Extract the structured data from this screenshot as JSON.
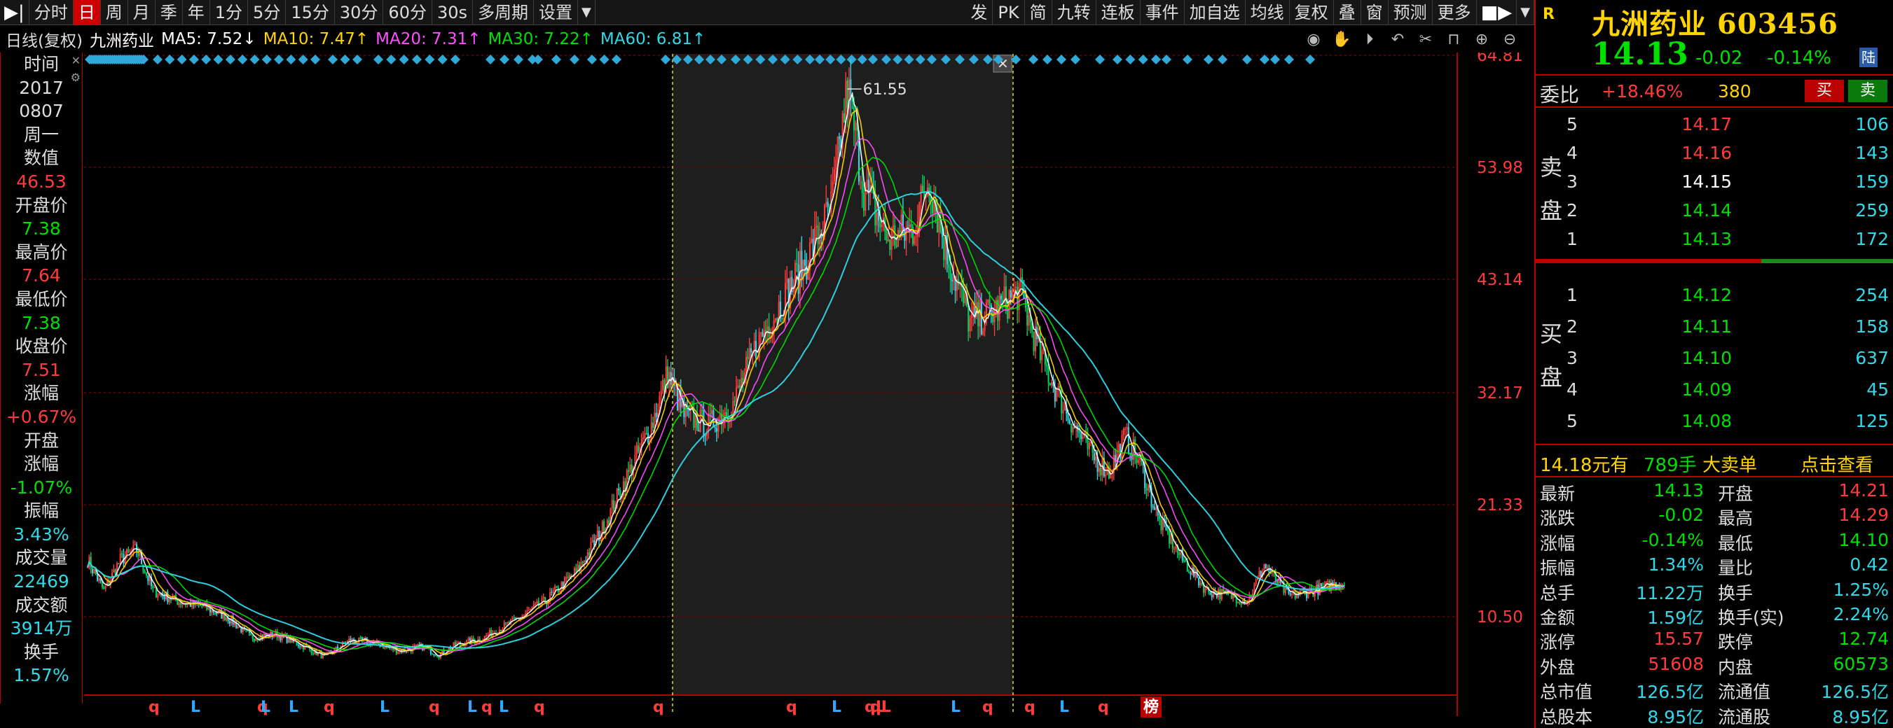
{
  "toolbar": {
    "items": [
      "分时",
      "日",
      "周",
      "月",
      "季",
      "年",
      "1分",
      "5分",
      "15分",
      "30分",
      "60分",
      "30s",
      "多周期",
      "设置"
    ],
    "active_index": 1,
    "right_items": [
      "发",
      "PK",
      "简",
      "九转",
      "连板",
      "事件",
      "加自选",
      "均线",
      "复权",
      "叠",
      "窗",
      "预测",
      "更多"
    ]
  },
  "chart_header": {
    "period": "日线(复权)",
    "stock": "九洲药业",
    "ma5": "MA5: 7.52↓",
    "ma10": "MA10: 7.47↑",
    "ma20": "MA20: 7.31↑",
    "ma30": "MA30: 7.22↑",
    "ma60": "MA60: 6.81↑"
  },
  "colors": {
    "ma5": "#ffffff",
    "ma10": "#ffd400",
    "ma20": "#ff50ff",
    "ma30": "#00e000",
    "ma60": "#30d8e8",
    "up": "#ff3b3b",
    "down": "#30d8e8",
    "grid": "#6a0000",
    "axis": "#b00000"
  },
  "left_panel": [
    {
      "t": "时间",
      "c": "lbl"
    },
    {
      "t": "2017",
      "c": "lbl"
    },
    {
      "t": "0807",
      "c": "lbl"
    },
    {
      "t": "周一",
      "c": "lbl"
    },
    {
      "t": "数值",
      "c": "lbl"
    },
    {
      "t": "46.53",
      "c": "red"
    },
    {
      "t": "开盘价",
      "c": "lbl"
    },
    {
      "t": "7.38",
      "c": "green"
    },
    {
      "t": "最高价",
      "c": "lbl"
    },
    {
      "t": "7.64",
      "c": "red"
    },
    {
      "t": "最低价",
      "c": "lbl"
    },
    {
      "t": "7.38",
      "c": "green"
    },
    {
      "t": "收盘价",
      "c": "lbl"
    },
    {
      "t": "7.51",
      "c": "red"
    },
    {
      "t": "涨幅",
      "c": "lbl"
    },
    {
      "t": "+0.67%",
      "c": "red"
    },
    {
      "t": "开盘",
      "c": "lbl"
    },
    {
      "t": "涨幅",
      "c": "lbl"
    },
    {
      "t": "-1.07%",
      "c": "green"
    },
    {
      "t": "振幅",
      "c": "lbl"
    },
    {
      "t": "3.43%",
      "c": "cyan"
    },
    {
      "t": "成交量",
      "c": "lbl"
    },
    {
      "t": "22469",
      "c": "cyan"
    },
    {
      "t": "成交额",
      "c": "lbl"
    },
    {
      "t": "3914万",
      "c": "cyan"
    },
    {
      "t": "换手",
      "c": "lbl"
    },
    {
      "t": "1.57%",
      "c": "cyan"
    }
  ],
  "chart_data": {
    "type": "candlestick",
    "y_ticks": [
      "64.81",
      "53.98",
      "43.14",
      "32.17",
      "21.33",
      "10.50"
    ],
    "ylim": [
      0.0,
      64.81
    ],
    "peak_label": "61.55",
    "x_markers": [
      "q",
      "L",
      "q",
      "L",
      "L",
      "q",
      "L",
      "q",
      "L",
      "q",
      "L",
      "q",
      "q",
      "q",
      "L",
      "qL",
      "qL",
      "L",
      "q",
      "q",
      "L",
      "q",
      "榜"
    ],
    "anchors": [
      [
        0,
        16
      ],
      [
        10,
        13
      ],
      [
        20,
        16
      ],
      [
        30,
        17
      ],
      [
        40,
        13
      ],
      [
        55,
        12
      ],
      [
        70,
        11.5
      ],
      [
        85,
        10.5
      ],
      [
        100,
        8.5
      ],
      [
        115,
        8.8
      ],
      [
        130,
        7.8
      ],
      [
        145,
        6.6
      ],
      [
        160,
        8.2
      ],
      [
        175,
        8.0
      ],
      [
        190,
        7.2
      ],
      [
        205,
        7.6
      ],
      [
        215,
        6.8
      ],
      [
        225,
        7.8
      ],
      [
        240,
        8.3
      ],
      [
        260,
        10.0
      ],
      [
        280,
        12.0
      ],
      [
        300,
        15.0
      ],
      [
        315,
        19.0
      ],
      [
        330,
        24.0
      ],
      [
        345,
        29.0
      ],
      [
        355,
        34.0
      ],
      [
        365,
        30.0
      ],
      [
        380,
        29.0
      ],
      [
        395,
        31.0
      ],
      [
        410,
        37.0
      ],
      [
        425,
        41.0
      ],
      [
        440,
        45.0
      ],
      [
        455,
        50.0
      ],
      [
        465,
        61.55
      ],
      [
        475,
        52.0
      ],
      [
        490,
        47.0
      ],
      [
        505,
        48.0
      ],
      [
        515,
        53.0
      ],
      [
        525,
        46.0
      ],
      [
        540,
        39.0
      ],
      [
        555,
        40.0
      ],
      [
        570,
        42.0
      ],
      [
        585,
        35.0
      ],
      [
        600,
        30.0
      ],
      [
        615,
        26.0
      ],
      [
        625,
        24.5
      ],
      [
        635,
        28.0
      ],
      [
        645,
        25.0
      ],
      [
        655,
        20.0
      ],
      [
        670,
        16.0
      ],
      [
        685,
        13.0
      ],
      [
        700,
        12.5
      ],
      [
        710,
        12.0
      ],
      [
        720,
        15.5
      ],
      [
        735,
        12.5
      ],
      [
        750,
        13.0
      ],
      [
        760,
        13.5
      ],
      [
        770,
        13.8
      ]
    ]
  },
  "right": {
    "logo": "R",
    "name": "九洲药业 603456",
    "price": "14.13",
    "change": "-0.02",
    "change_pct": "-0.14%",
    "market": "陆",
    "weibi_label": "委比",
    "weibi": "+18.46%",
    "weibi_num": "380",
    "buy": "买",
    "sell": "卖",
    "sell_label": [
      "卖",
      "盘"
    ],
    "buy_label": [
      "买",
      "盘"
    ],
    "asks": [
      {
        "lvl": "5",
        "p": "14.17",
        "v": "106",
        "c": "red"
      },
      {
        "lvl": "4",
        "p": "14.16",
        "v": "143",
        "c": "red"
      },
      {
        "lvl": "3",
        "p": "14.15",
        "v": "159",
        "c": "white"
      },
      {
        "lvl": "2",
        "p": "14.14",
        "v": "259",
        "c": "green"
      },
      {
        "lvl": "1",
        "p": "14.13",
        "v": "172",
        "c": "green"
      }
    ],
    "bids": [
      {
        "lvl": "1",
        "p": "14.12",
        "v": "254",
        "c": "green"
      },
      {
        "lvl": "2",
        "p": "14.11",
        "v": "158",
        "c": "green"
      },
      {
        "lvl": "3",
        "p": "14.10",
        "v": "637",
        "c": "green"
      },
      {
        "lvl": "4",
        "p": "14.09",
        "v": "45",
        "c": "green"
      },
      {
        "lvl": "5",
        "p": "14.08",
        "v": "125",
        "c": "green"
      }
    ],
    "ad": {
      "price": "14.18元有",
      "hand": "789手",
      "big": "大卖单",
      "link": "点击查看"
    },
    "stats": [
      {
        "k1": "最新",
        "v1": "14.13",
        "c1": "green",
        "k2": "开盘",
        "v2": "14.21",
        "c2": "red"
      },
      {
        "k1": "涨跌",
        "v1": "-0.02",
        "c1": "green",
        "k2": "最高",
        "v2": "14.29",
        "c2": "red"
      },
      {
        "k1": "涨幅",
        "v1": "-0.14%",
        "c1": "green",
        "k2": "最低",
        "v2": "14.10",
        "c2": "green"
      },
      {
        "k1": "振幅",
        "v1": "1.34%",
        "c1": "cyan",
        "k2": "量比",
        "v2": "0.42",
        "c2": "cyan"
      },
      {
        "k1": "总手",
        "v1": "11.22万",
        "c1": "cyan",
        "k2": "换手",
        "v2": "1.25%",
        "c2": "cyan"
      },
      {
        "k1": "金额",
        "v1": "1.59亿",
        "c1": "cyan",
        "k2": "换手(实)",
        "v2": "2.24%",
        "c2": "cyan"
      },
      {
        "k1": "涨停",
        "v1": "15.57",
        "c1": "red",
        "k2": "跌停",
        "v2": "12.74",
        "c2": "green"
      },
      {
        "k1": "外盘",
        "v1": "51608",
        "c1": "red",
        "k2": "内盘",
        "v2": "60573",
        "c2": "green"
      },
      {
        "k1": "总市值",
        "v1": "126.5亿",
        "c1": "cyan",
        "k2": "流通值",
        "v2": "126.5亿",
        "c2": "cyan"
      },
      {
        "k1": "总股本",
        "v1": "8.95亿",
        "c1": "cyan",
        "k2": "流通股",
        "v2": "8.95亿",
        "c2": "cyan"
      }
    ]
  }
}
